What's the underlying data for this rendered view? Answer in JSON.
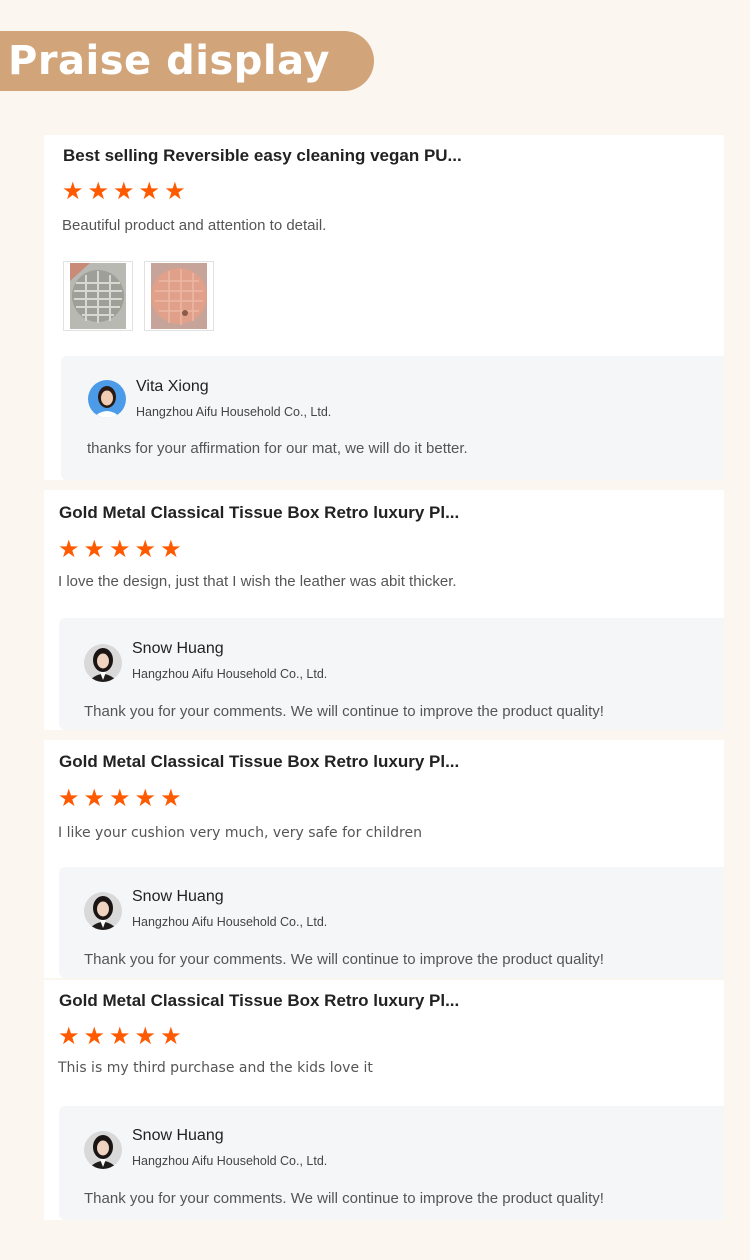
{
  "header": {
    "title": "Praise display"
  },
  "reviews": [
    {
      "product": "Best selling Reversible easy cleaning vegan PU...",
      "rating": 5,
      "text": "Beautiful product and attention to detail.",
      "reply": {
        "name": "Vita Xiong",
        "company": "Hangzhou Aifu Household Co., Ltd.",
        "text": "thanks for your affirmation for our mat, we will do it better."
      }
    },
    {
      "product": "Gold Metal Classical Tissue Box Retro luxury Pl...",
      "rating": 5,
      "text": "I love the design, just that I wish the leather was abit thicker.",
      "reply": {
        "name": "Snow Huang",
        "company": "Hangzhou Aifu Household Co., Ltd.",
        "text": "Thank you for your comments. We will continue to improve the product quality!"
      }
    },
    {
      "product": "Gold Metal Classical Tissue Box Retro luxury Pl...",
      "rating": 5,
      "text": "I like your cushion very much, very safe for children",
      "reply": {
        "name": "Snow Huang",
        "company": "Hangzhou Aifu Household Co., Ltd.",
        "text": "Thank you for your comments. We will continue to improve the product quality!"
      }
    },
    {
      "product": "Gold Metal Classical Tissue Box Retro luxury Pl...",
      "rating": 5,
      "text": "This is my third purchase and the kids love it",
      "reply": {
        "name": "Snow Huang",
        "company": "Hangzhou Aifu Household Co., Ltd.",
        "text": "Thank you for your comments. We will continue to improve the product quality!"
      }
    }
  ],
  "colors": {
    "banner": "#d1a47a",
    "star": "#ff5a00",
    "background": "#fcf6f0"
  },
  "icons": {
    "star": "star-icon",
    "avatar": "avatar"
  }
}
